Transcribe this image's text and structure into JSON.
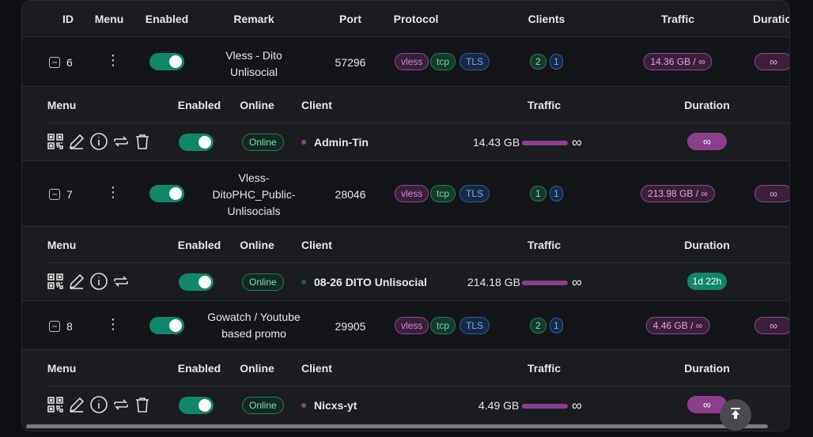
{
  "columns": {
    "id": "ID",
    "menu": "Menu",
    "enabled": "Enabled",
    "remark": "Remark",
    "port": "Port",
    "protocol": "Protocol",
    "clients": "Clients",
    "traffic": "Traffic",
    "duration": "Duratio"
  },
  "sub_columns": {
    "menu": "Menu",
    "enabled": "Enabled",
    "online": "Online",
    "client": "Client",
    "traffic": "Traffic",
    "duration": "Duration"
  },
  "inbounds": [
    {
      "id": "6",
      "remark_line1": "Vless - Dito",
      "remark_line2": "Unlisocial",
      "remark_line3": "",
      "port": "57296",
      "tags": [
        "vless",
        "tcp",
        "TLS"
      ],
      "clients_total": "2",
      "clients_online": "1",
      "traffic": "14.36 GB / ∞",
      "duration": "∞",
      "client": {
        "online": "Online",
        "name": "Admin-Tin",
        "traffic": "14.43 GB",
        "limit": "∞",
        "duration": "∞",
        "dot_color": "#8a3f8c",
        "duration_color": "#8a3f8c"
      }
    },
    {
      "id": "7",
      "remark_line1": "Vless-",
      "remark_line2": "DitoPHC_Public-",
      "remark_line3": "Unlisocials",
      "port": "28046",
      "tags": [
        "vless",
        "tcp",
        "TLS"
      ],
      "clients_total": "1",
      "clients_online": "1",
      "traffic": "213.98 GB / ∞",
      "duration": "∞",
      "client": {
        "online": "Online",
        "name": "08-26 DITO Unlisocial",
        "traffic": "214.18 GB",
        "limit": "∞",
        "duration": "1d 22h",
        "dot_color": "#1f5a44",
        "duration_color": "#10866a"
      }
    },
    {
      "id": "8",
      "remark_line1": "Gowatch / Youtube",
      "remark_line2": "based promo",
      "remark_line3": "",
      "port": "29905",
      "tags": [
        "vless",
        "tcp",
        "TLS"
      ],
      "clients_total": "2",
      "clients_online": "1",
      "traffic": "4.46 GB / ∞",
      "duration": "∞",
      "client": {
        "online": "Online",
        "name": "Nicxs-yt",
        "traffic": "4.49 GB",
        "limit": "∞",
        "duration": "∞",
        "dot_color": "#8a3f8c",
        "duration_color": "#8a3f8c"
      }
    }
  ],
  "icons": [
    "qr-code-icon",
    "edit-icon",
    "info-icon",
    "reset-icon",
    "delete-icon",
    "scroll-to-top-icon",
    "collapse-icon",
    "more-menu-icon"
  ]
}
